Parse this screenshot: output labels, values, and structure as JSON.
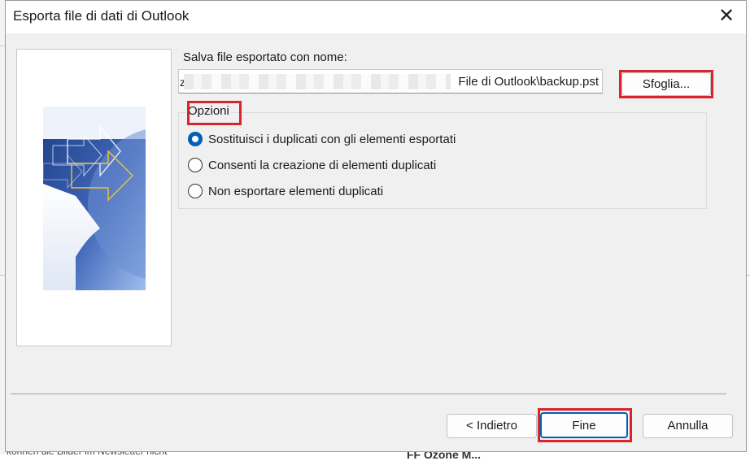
{
  "background_fragments": {
    "bottom_text": "können die Bilder im Newsletter nicht",
    "bottom_heading": "FF Ozone M..."
  },
  "dialog": {
    "title": "Esporta file di dati di Outlook",
    "save_label": "Salva file esportato con nome:",
    "path_prefix": "z",
    "path_value": "File di Outlook\\backup.pst",
    "browse_button": "Sfoglia...",
    "options_group_label": "Opzioni",
    "options": [
      {
        "label": "Sostituisci i duplicati con gli elementi esportati",
        "selected": true
      },
      {
        "label": "Consenti la creazione di elementi duplicati",
        "selected": false
      },
      {
        "label": "Non esportare elementi duplicati",
        "selected": false
      }
    ],
    "back_button": "< Indietro",
    "finish_button": "Fine",
    "cancel_button": "Annulla"
  },
  "colors": {
    "highlight": "#d9242b",
    "radio_selected": "#005fb8",
    "dialog_bg": "#f0f0f0"
  },
  "icons": {
    "close": "close-icon",
    "wizard_graphic": "export-arrows-illustration"
  }
}
